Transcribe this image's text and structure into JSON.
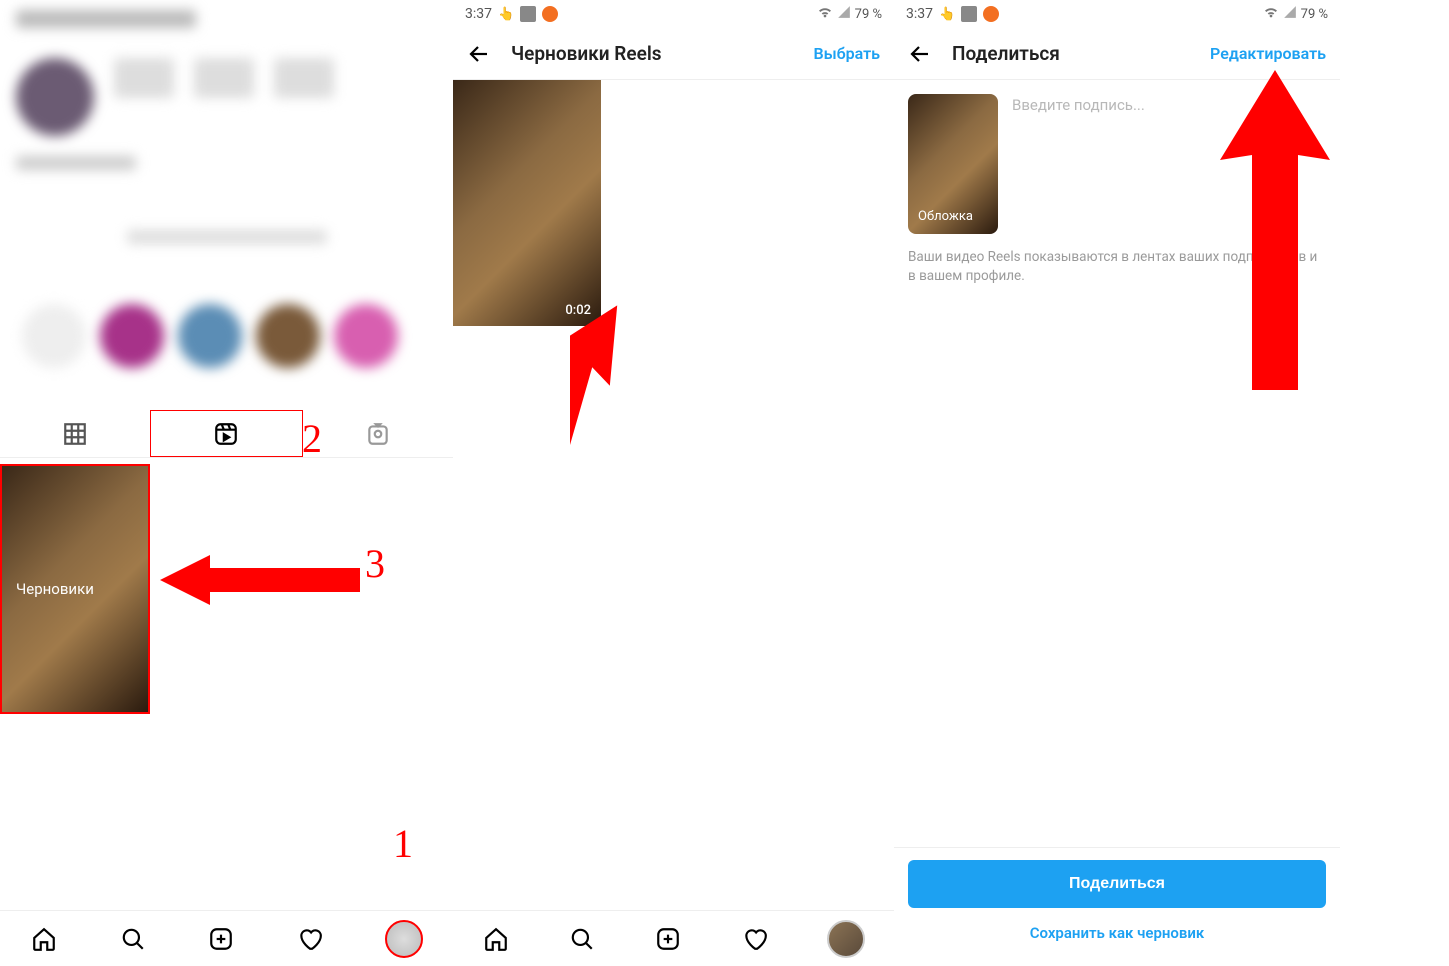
{
  "status": {
    "time": "3:37",
    "battery": "79 %"
  },
  "panel1": {
    "draft_label": "Черновики",
    "annotations": {
      "num1": "1",
      "num2": "2",
      "num3": "3"
    }
  },
  "panel2": {
    "title": "Черновики Reels",
    "select_action": "Выбрать",
    "thumb_duration": "0:02"
  },
  "panel3": {
    "title": "Поделиться",
    "edit_action": "Редактировать",
    "cover_label": "Обложка",
    "caption_placeholder": "Введите подпись...",
    "hint": "Ваши видео Reels показываются в лентах ваших подписчиков и в вашем профиле.",
    "share_button": "Поделиться",
    "save_draft_link": "Сохранить как черновик"
  }
}
